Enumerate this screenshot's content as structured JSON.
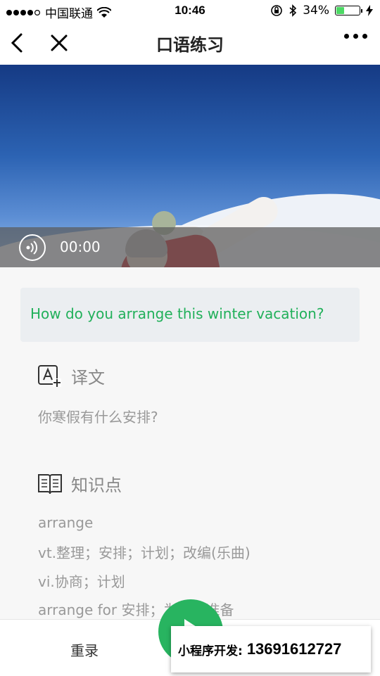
{
  "status_bar": {
    "carrier": "中国联通",
    "time": "10:46",
    "battery_percent": "34%",
    "battery_level": 0.34,
    "signal_icon": "signal-dots-icon",
    "wifi_icon": "wifi-icon",
    "lock_icon": "rotation-lock-icon",
    "bluetooth_icon": "bluetooth-icon",
    "charging_icon": "charging-bolt-icon"
  },
  "nav": {
    "title": "口语练习",
    "back_icon": "back-arrow-icon",
    "close_icon": "close-icon",
    "more_icon": "more-dots-icon"
  },
  "audio": {
    "time": "00:00",
    "icon": "audio-wave-icon"
  },
  "sentence": "How do you arrange this winter vacation?",
  "translation_section": {
    "label": "译文",
    "icon": "translate-icon",
    "text": "你寒假有什么安排?"
  },
  "knowledge_section": {
    "label": "知识点",
    "icon": "book-icon",
    "lines": [
      "arrange",
      "vt.整理；安排；计划；改编(乐曲)",
      "vi.协商；计划",
      "arrange for 安排；为…做准备"
    ]
  },
  "bottom_bar": {
    "rerecord_label": "重录",
    "record_icon": "play-icon"
  },
  "watermark": {
    "label": "小程序开发:",
    "phone": "13691612727"
  },
  "colors": {
    "accent": "#21b05a",
    "record_button": "#28b460"
  }
}
